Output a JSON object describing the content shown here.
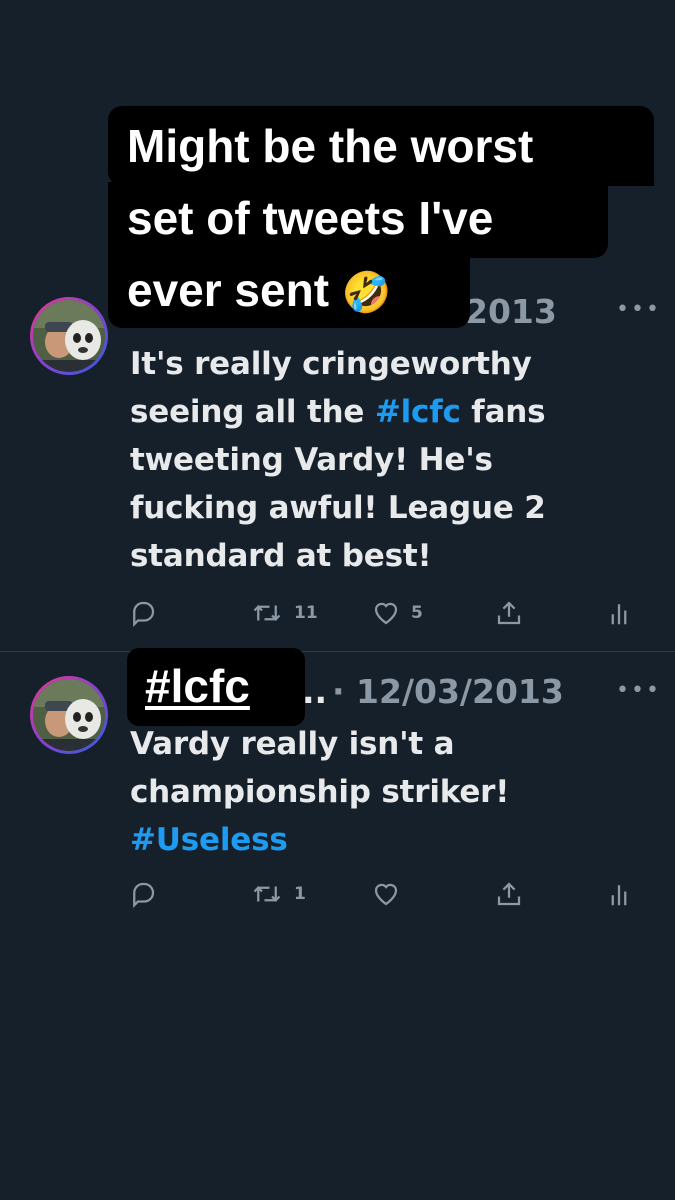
{
  "caption": {
    "line1": "Might be the worst",
    "line2": "set of tweets I've",
    "line3": "ever sent",
    "emoji": "🤣"
  },
  "tweets": [
    {
      "date_visible": "2013",
      "text_before": "It's really cringeworthy seeing all the ",
      "hashtag": "#lcfc",
      "text_after": " fans tweeting Vardy! He's fucking awful! League 2 standard at best!",
      "replies": "",
      "retweets": "11",
      "likes": "5"
    },
    {
      "overlay_tag": "#lcfc",
      "name_truncated": "..",
      "date_visible": "· 12/03/2013",
      "text": "Vardy really isn't a championship striker!",
      "hashtag": "#Useless",
      "replies": "",
      "retweets": "1",
      "likes": ""
    }
  ],
  "icons": {
    "more": "more-horizontal-icon",
    "reply": "reply-icon",
    "retweet": "retweet-icon",
    "like": "heart-icon",
    "share": "share-icon",
    "analytics": "analytics-icon"
  },
  "colors": {
    "background": "#15202b",
    "hashtag": "#1d9bf0",
    "muted": "#8b98a5",
    "caption_bg": "#000000"
  }
}
